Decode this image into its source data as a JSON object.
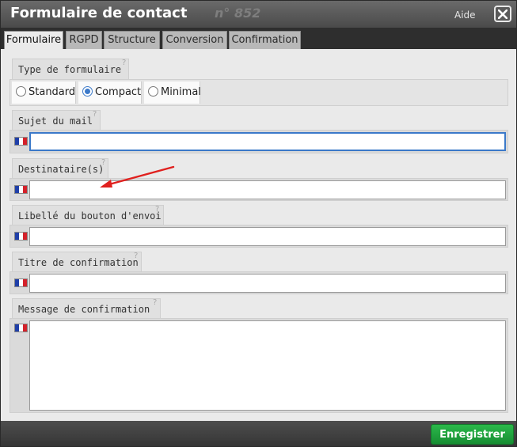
{
  "window": {
    "title": "Formulaire de contact",
    "number": "n° 852",
    "help_label": "Aide"
  },
  "tabs": [
    {
      "label": "Formulaire",
      "active": true
    },
    {
      "label": "RGPD",
      "active": false
    },
    {
      "label": "Structure",
      "active": false
    },
    {
      "label": "Conversion",
      "active": false
    },
    {
      "label": "Confirmation",
      "active": false
    }
  ],
  "form": {
    "form_type": {
      "label": "Type de formulaire",
      "help": "?",
      "options": [
        {
          "label": "Standard",
          "selected": false
        },
        {
          "label": "Compact",
          "selected": true
        },
        {
          "label": "Minimal",
          "selected": false
        }
      ]
    },
    "fields": [
      {
        "label": "Sujet du mail",
        "help": "?",
        "value": "",
        "lang_icon": "french-flag-icon"
      },
      {
        "label": "Destinataire(s)",
        "help": "?",
        "value": "",
        "lang_icon": "french-flag-icon"
      },
      {
        "label": "Libellé du bouton d'envoi",
        "help": "?",
        "value": "",
        "lang_icon": "french-flag-icon"
      },
      {
        "label": "Titre de confirmation",
        "help": "?",
        "value": "",
        "lang_icon": "french-flag-icon"
      }
    ],
    "message": {
      "label": "Message de confirmation",
      "help": "?",
      "value": "",
      "lang_icon": "french-flag-icon"
    }
  },
  "footer": {
    "save_label": "Enregistrer"
  },
  "colors": {
    "accent": "#3b79c9",
    "save_button": "#1fa33e",
    "annotation_arrow": "#e0201e"
  }
}
